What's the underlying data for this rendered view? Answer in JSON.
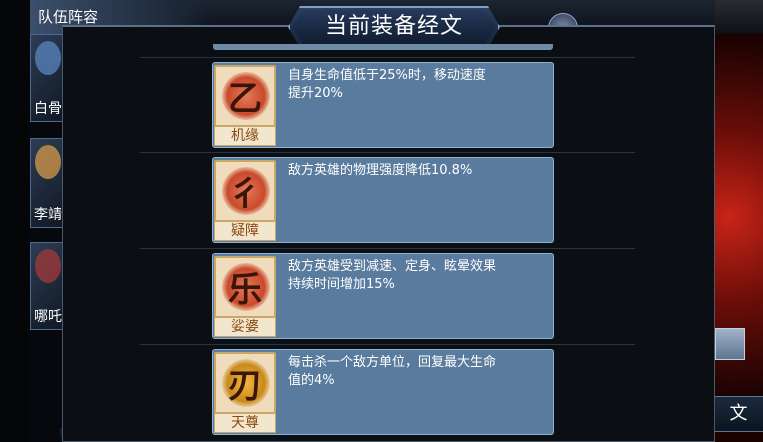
{
  "background": {
    "title": "队伍阵容",
    "heroes": [
      {
        "name": "白骨"
      },
      {
        "name": "李靖"
      },
      {
        "name": "哪吒"
      }
    ],
    "right_button_label": "文"
  },
  "modal": {
    "title": "当前装备经文",
    "runes": [
      {
        "name": "机缘",
        "icon": "rune-jiyuan-icon",
        "description": "自身生命值低于25%时，移动速度提升20%"
      },
      {
        "name": "疑障",
        "icon": "rune-yizhang-icon",
        "description": "敌方英雄的物理强度降低10.8%"
      },
      {
        "name": "娑婆",
        "icon": "rune-suopo-icon",
        "description": "敌方英雄受到减速、定身、眩晕效果持续时间增加15%"
      },
      {
        "name": "天尊",
        "icon": "rune-tianzun-icon",
        "description": "每击杀一个敌方单位，回复最大生命值的4%"
      }
    ]
  },
  "colors": {
    "panel": "#587b9e",
    "rune_name": "#8b4a12",
    "header_border": "#7fa0c6"
  }
}
